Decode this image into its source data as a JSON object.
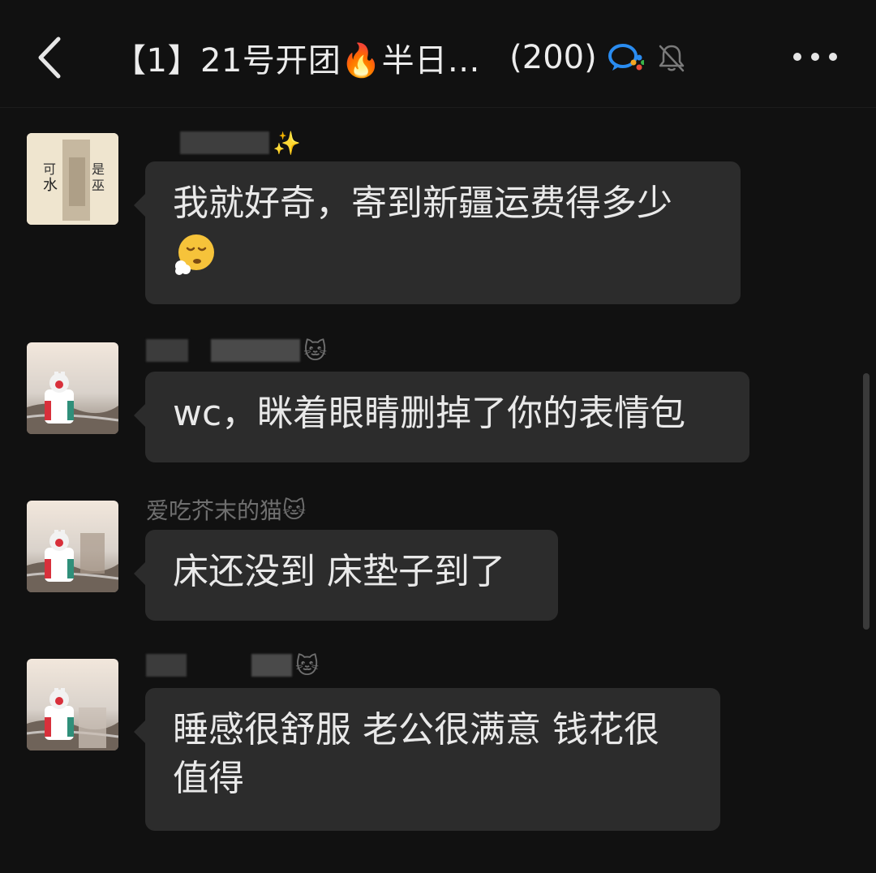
{
  "header": {
    "title": "【1】21号开团🔥半日…",
    "member_count": "(200)",
    "back_icon": "chevron-left-icon",
    "more_icon": "more-horizontal-icon",
    "badge_icon": "enterprise-wechat-icon",
    "mute_icon": "bell-muted-icon"
  },
  "messages": [
    {
      "nickname_suffix": "✨",
      "text": "我就好奇，寄到新疆运费得多少",
      "emoji": "sighing-face"
    },
    {
      "nickname_suffix": "🐱",
      "text": "wc，眯着眼睛删掉了你的表情包"
    },
    {
      "nickname": "爱吃芥末的猫",
      "nickname_suffix": "🐱",
      "text": "床还没到 床垫子到了"
    },
    {
      "nickname_suffix": "🐱",
      "text": "睡感很舒服 老公很满意 钱花很值得"
    }
  ],
  "colors": {
    "background": "#111111",
    "bubble": "#2c2c2c",
    "text": "#e9e9e9",
    "nickname": "#6f6f6f",
    "badge_blue": "#2a8cf0"
  }
}
